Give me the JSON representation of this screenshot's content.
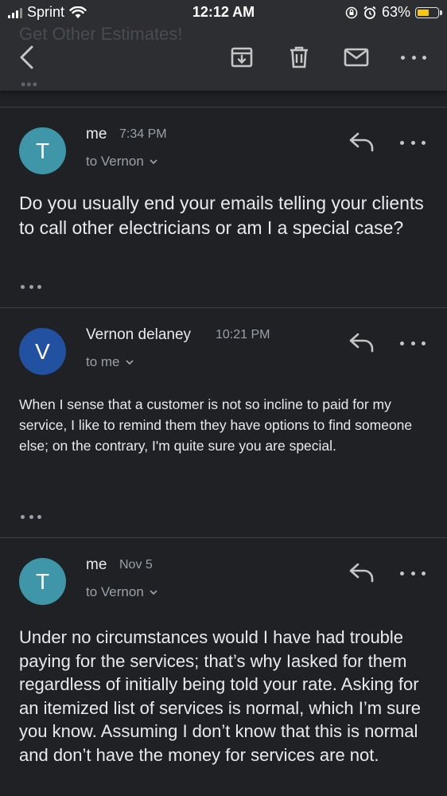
{
  "status_bar": {
    "carrier": "Sprint",
    "time": "12:12 AM",
    "battery": "63%",
    "battery_level": 0.63,
    "icons": [
      "signal-icon",
      "wifi-icon",
      "orientation-lock-icon",
      "alarm-icon",
      "battery-icon"
    ]
  },
  "toolbar": {
    "subject_ghost": "Get Other Estimates!",
    "actions": [
      "back-icon",
      "archive-icon",
      "delete-icon",
      "mail-icon",
      "more-icon"
    ]
  },
  "messages": [
    {
      "avatar_letter": "T",
      "avatar_color": "#3e96a8",
      "sender": "me",
      "time": "7:34 PM",
      "recipient": "to Vernon",
      "body": "Do you usually end your emails telling your clients to call other electricians or am I a special case?"
    },
    {
      "avatar_letter": "V",
      "avatar_color": "#2351a1",
      "sender": "Vernon delaney",
      "time": "10:21 PM",
      "recipient": "to me",
      "body": "When I sense that a customer is not so incline to paid for my service, I like to remind them they have options to find someone else; on the contrary, I'm quite sure you are special."
    },
    {
      "avatar_letter": "T",
      "avatar_color": "#3e96a8",
      "sender": "me",
      "time": "Nov 5",
      "recipient": "to Vernon",
      "body": "Under no circumstances would I have had trouble paying for the services; that’s why Iasked for them regardless of initially being told your rate. Asking for an itemized list of services is normal, which I’m sure you know. Assuming I don’t know that this is normal and don’t have the money for services are not."
    }
  ]
}
